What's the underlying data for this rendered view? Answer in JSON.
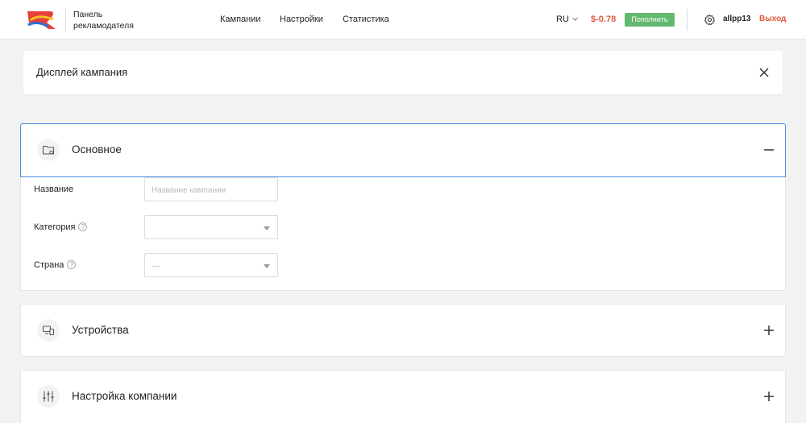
{
  "header": {
    "brand": "Панель рекламодателя",
    "nav": [
      "Кампании",
      "Настройки",
      "Статистика"
    ],
    "lang": "RU",
    "balance": "$-0.78",
    "topup_label": "Пополнить",
    "username": "allpp13",
    "logout_label": "Выход"
  },
  "page": {
    "title": "Дисплей кампания"
  },
  "sections": {
    "main": {
      "title": "Основное",
      "fields": {
        "name_label": "Название",
        "name_placeholder": "Название кампании",
        "category_label": "Категория",
        "category_value": "",
        "country_label": "Страна",
        "country_value": "—"
      }
    },
    "devices": {
      "title": "Устройства"
    },
    "company_settings": {
      "title": "Настройка компании"
    }
  },
  "icons": {
    "main": "folder-settings-icon",
    "devices": "devices-icon",
    "company_settings": "sliders-icon"
  },
  "colors": {
    "accent_border": "#4a8fd6",
    "balance": "#e05a3a",
    "topup": "#63b96f",
    "logout": "#e05a3a"
  }
}
